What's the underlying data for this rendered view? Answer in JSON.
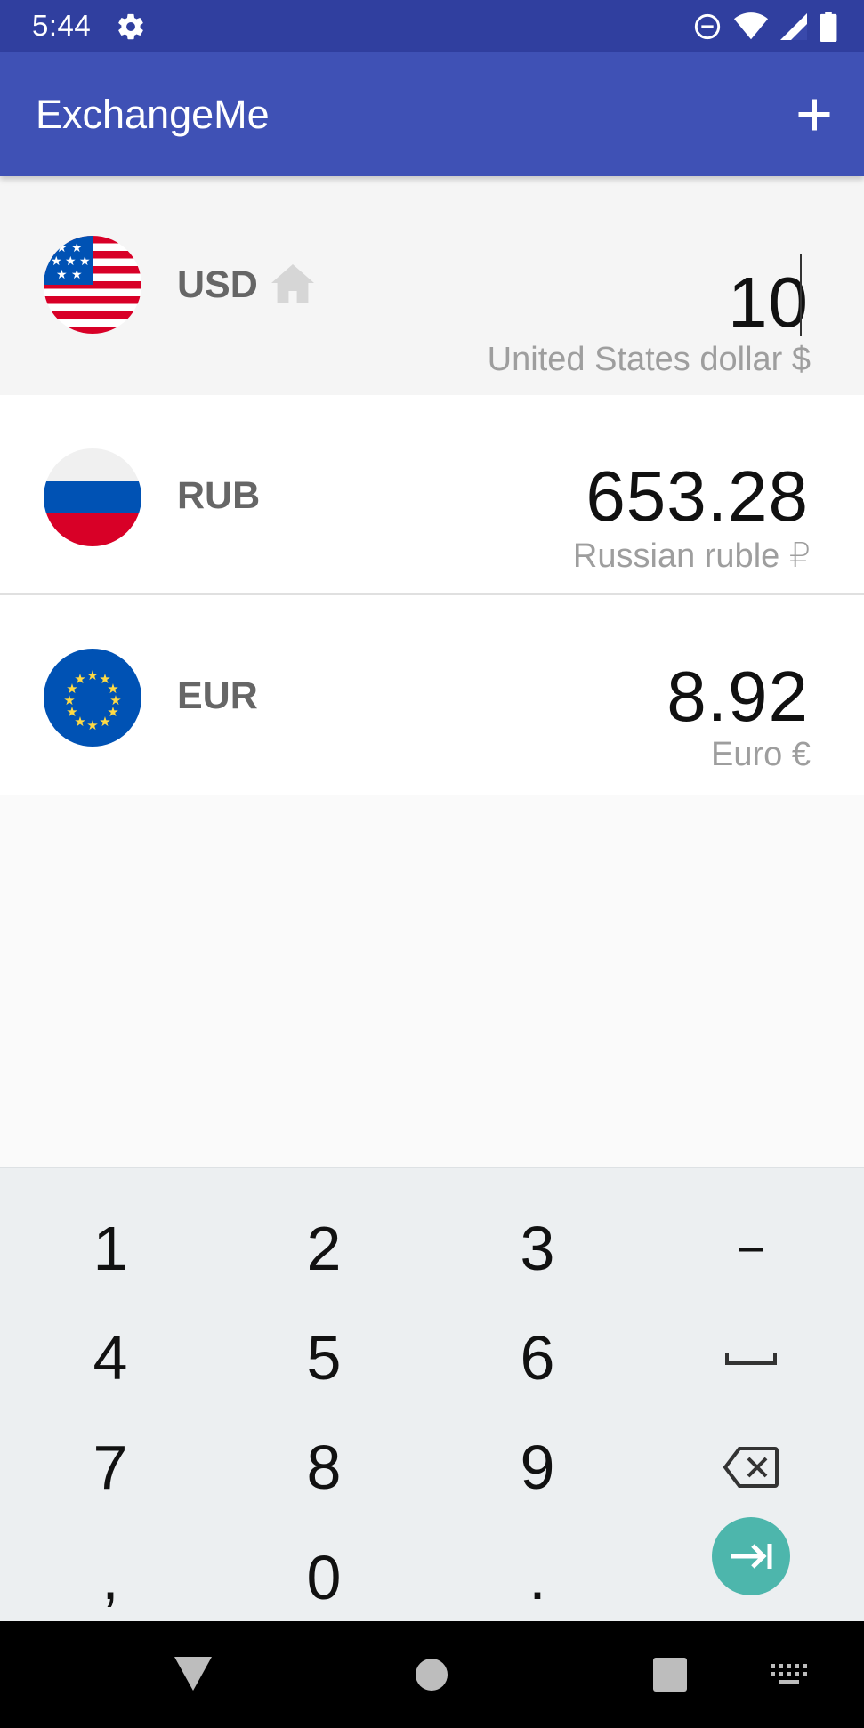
{
  "status_bar": {
    "time": "5:44"
  },
  "app_bar": {
    "title": "ExchangeMe",
    "add_icon": "plus-icon"
  },
  "currencies": [
    {
      "code": "USD",
      "amount": "10",
      "name": "United States dollar $",
      "is_home": true,
      "flag": "us-flag"
    },
    {
      "code": "RUB",
      "amount": "653.28",
      "name": "Russian ruble ₽",
      "is_home": false,
      "flag": "ru-flag"
    },
    {
      "code": "EUR",
      "amount": "8.92",
      "name": "Euro €",
      "is_home": false,
      "flag": "eu-flag"
    }
  ],
  "keyboard": {
    "rows": [
      [
        "1",
        "2",
        "3",
        "−"
      ],
      [
        "4",
        "5",
        "6",
        "space"
      ],
      [
        "7",
        "8",
        "9",
        "backspace"
      ],
      [
        ",",
        "0",
        ".",
        "next"
      ]
    ]
  },
  "colors": {
    "status_bar": "#303f9f",
    "app_bar": "#3f51b5",
    "go_button": "#4db6ac",
    "keyboard_bg": "#eceff1"
  }
}
